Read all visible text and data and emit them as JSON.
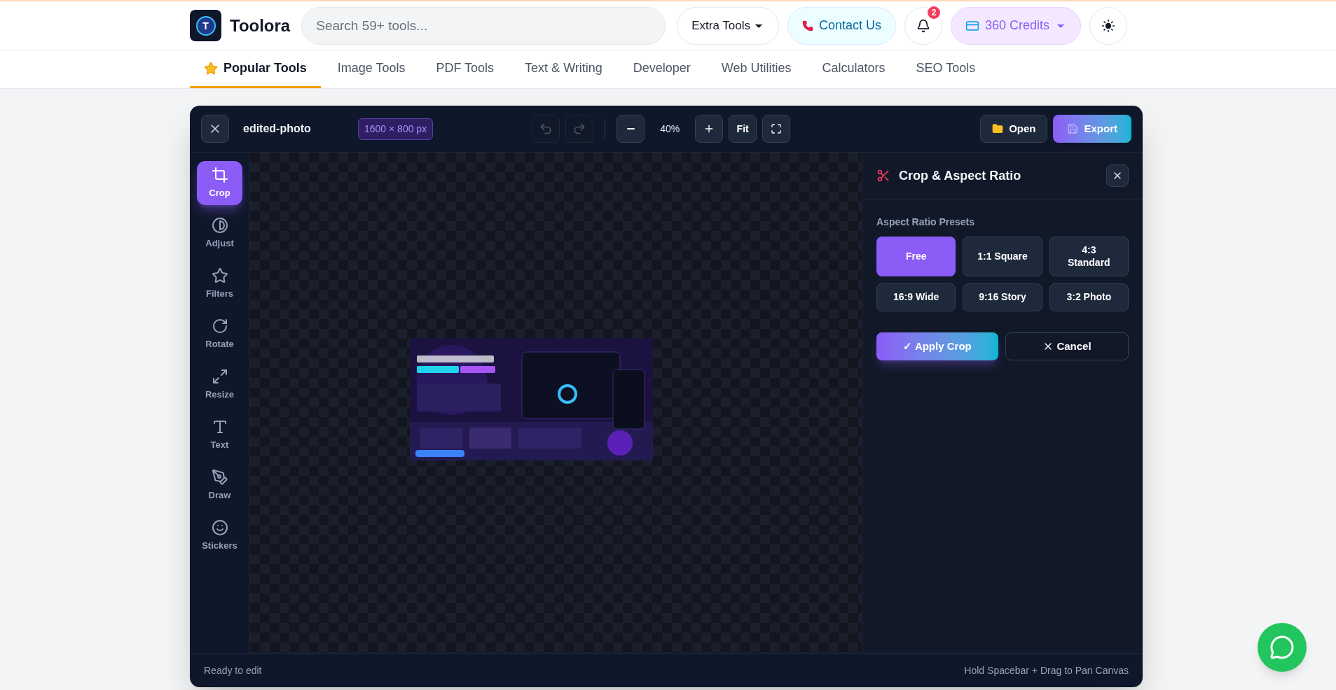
{
  "brand": {
    "name": "Toolora",
    "logo_letter": "T"
  },
  "search": {
    "placeholder": "Search 59+ tools..."
  },
  "header_actions": {
    "extra_tools": "Extra Tools",
    "contact": "Contact Us",
    "notifications": "2",
    "credits": "360 Credits"
  },
  "nav": [
    {
      "label": "Popular Tools",
      "selected": true
    },
    {
      "label": "Image Tools",
      "selected": false
    },
    {
      "label": "PDF Tools",
      "selected": false
    },
    {
      "label": "Text & Writing",
      "selected": false
    },
    {
      "label": "Developer",
      "selected": false
    },
    {
      "label": "Web Utilities",
      "selected": false
    },
    {
      "label": "Calculators",
      "selected": false
    },
    {
      "label": "SEO Tools",
      "selected": false
    }
  ],
  "editor": {
    "file_name": "edited-photo",
    "dimensions": "1600 × 800 px",
    "undo_disabled": true,
    "redo_disabled": true,
    "zoom": "40%",
    "fit": "Fit",
    "open": "Open",
    "export": "Export",
    "tools": [
      {
        "label": "Crop",
        "selected": true
      },
      {
        "label": "Adjust",
        "selected": false
      },
      {
        "label": "Filters",
        "selected": false
      },
      {
        "label": "Rotate",
        "selected": false
      },
      {
        "label": "Resize",
        "selected": false
      },
      {
        "label": "Text",
        "selected": false
      },
      {
        "label": "Draw",
        "selected": false
      },
      {
        "label": "Stickers",
        "selected": false
      }
    ],
    "panel": {
      "title": "Crop & Aspect Ratio",
      "section": "Aspect Ratio Presets",
      "presets": [
        {
          "label": "Free",
          "selected": true
        },
        {
          "label": "1:1 Square",
          "selected": false
        },
        {
          "label": "4:3 Standard",
          "selected": false
        },
        {
          "label": "16:9 Wide",
          "selected": false
        },
        {
          "label": "9:16 Story",
          "selected": false
        },
        {
          "label": "3:2 Photo",
          "selected": false
        }
      ],
      "apply": "✓ Apply Crop",
      "cancel": "Cancel"
    },
    "status_left": "Ready to edit",
    "status_right": "Hold Spacebar + Drag to Pan Canvas"
  }
}
